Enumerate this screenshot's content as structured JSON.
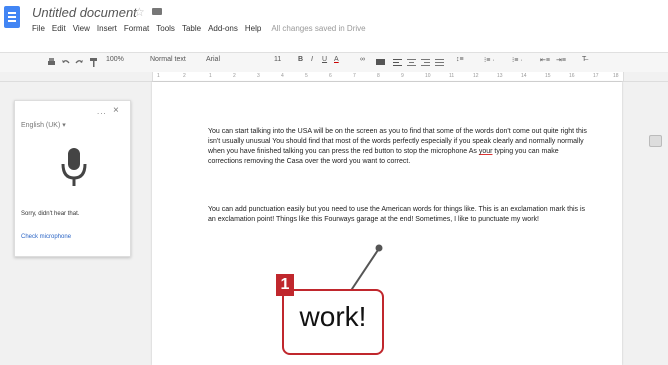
{
  "app": {
    "doc_title": "Untitled document",
    "save_status": "All changes saved in Drive",
    "menu": [
      "File",
      "Edit",
      "View",
      "Insert",
      "Format",
      "Tools",
      "Table",
      "Add-ons",
      "Help"
    ]
  },
  "toolbar": {
    "zoom": "100%",
    "style": "Normal text",
    "font": "Arial",
    "size": "11"
  },
  "ruler": [
    "1",
    "2",
    "1",
    "2",
    "3",
    "4",
    "5",
    "6",
    "7",
    "8",
    "9",
    "10",
    "11",
    "12",
    "13",
    "14",
    "15",
    "16",
    "17",
    "18"
  ],
  "voice": {
    "dots": "...",
    "close": "×",
    "language": "English (UK) ▾",
    "message": "Sorry, didn't hear that.",
    "link": "Check microphone"
  },
  "document": {
    "para1_a": "You can start talking into the USA will be on the screen as you to find that some of the words don't come out quite right this isn't usually unusual You should find that most of the words perfectly especially if you speak clearly and normally normally when you have finished talking you can press the red button to stop the microphone As ",
    "para1_under": "your",
    "para1_b": " typing you can make corrections removing the Casa over the word you want to correct.",
    "para2": "You can add punctuation easily but you need to use the American words for things like. This is an exclamation mark this is an exclamation point! Things like this Fourways garage at the end! Sometimes, I like to punctuate my work!"
  },
  "callout": {
    "number": "1",
    "text": "work!"
  }
}
